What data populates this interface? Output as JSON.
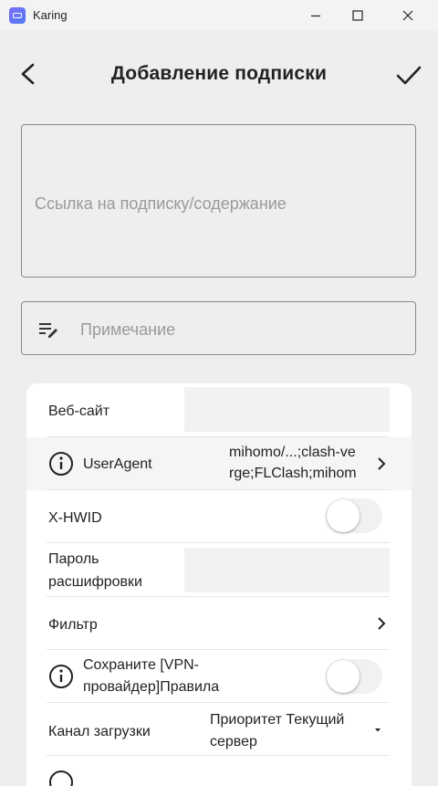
{
  "window": {
    "title": "Karing"
  },
  "header": {
    "title": "Добавление подписки"
  },
  "link_input": {
    "placeholder": "Ссылка на подписку/содержание",
    "value": ""
  },
  "remark_input": {
    "placeholder": "Примечание",
    "value": ""
  },
  "settings": {
    "website": {
      "label": "Веб-сайт",
      "value": ""
    },
    "user_agent": {
      "label": "UserAgent",
      "value_line1": "mihomo/...;clash-ve",
      "value_line2": "rge;FLClash;mihom"
    },
    "hwid": {
      "label": "X-HWID",
      "enabled": false
    },
    "decrypt_password": {
      "label_line1": "Пароль",
      "label_line2": "расшифровки",
      "value": ""
    },
    "filter": {
      "label": "Фильтр"
    },
    "save_rules": {
      "label_line1": "Сохраните [VPN-",
      "label_line2": "провайдер]Правила",
      "enabled": false
    },
    "download_channel": {
      "label": "Канал загрузки",
      "value_line1": "Приоритет Текущий",
      "value_line2": "сервер"
    }
  },
  "colors": {
    "background": "#eeeeee",
    "card": "#ffffff",
    "field_border": "#8a8a8a",
    "placeholder": "#9a9a9a"
  }
}
